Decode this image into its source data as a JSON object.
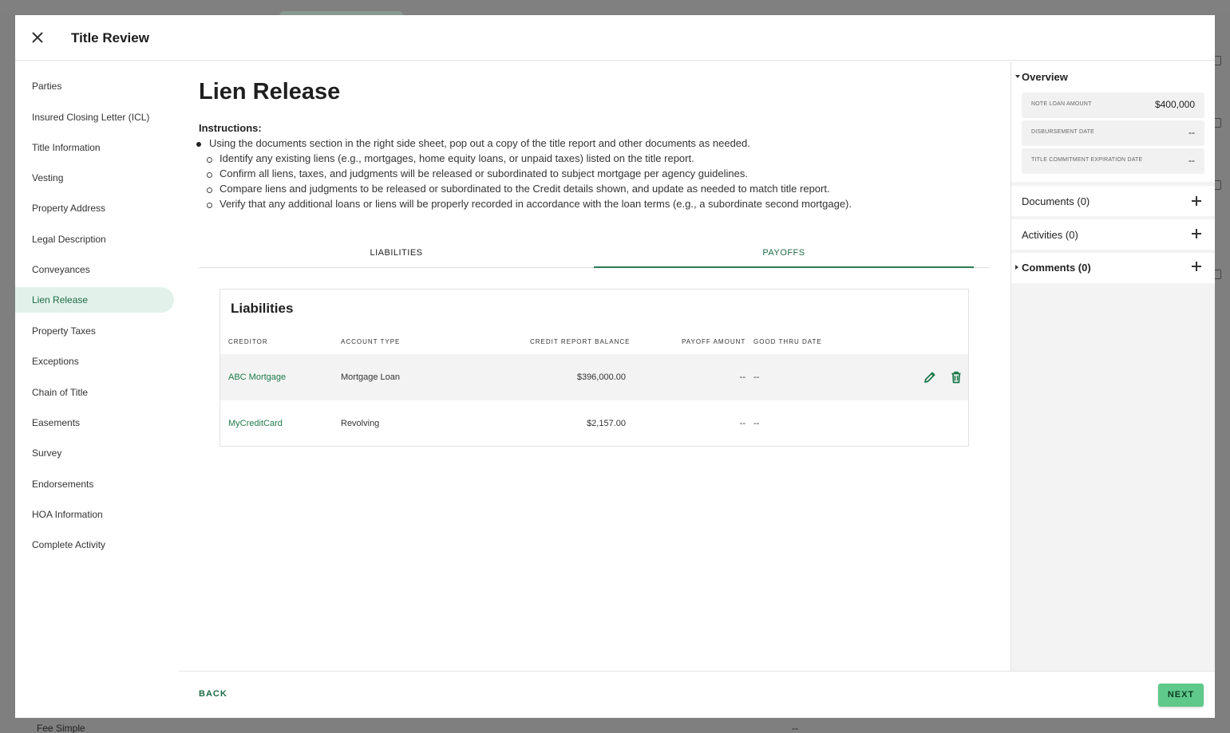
{
  "background": {
    "fee_text": "Fee Simple",
    "dash_text": "--"
  },
  "header": {
    "title": "Title Review",
    "close_icon": "close-icon"
  },
  "sidebar": {
    "items": [
      {
        "label": "Parties"
      },
      {
        "label": "Insured Closing Letter (ICL)"
      },
      {
        "label": "Title Information"
      },
      {
        "label": "Vesting"
      },
      {
        "label": "Property Address"
      },
      {
        "label": "Legal Description"
      },
      {
        "label": "Conveyances"
      },
      {
        "label": "Lien Release",
        "active": true
      },
      {
        "label": "Property Taxes"
      },
      {
        "label": "Exceptions"
      },
      {
        "label": "Chain of Title"
      },
      {
        "label": "Easements"
      },
      {
        "label": "Survey"
      },
      {
        "label": "Endorsements"
      },
      {
        "label": "HOA Information"
      },
      {
        "label": "Complete Activity"
      }
    ]
  },
  "main": {
    "title": "Lien Release",
    "instructions_label": "Instructions:",
    "instructions": {
      "main": "Using the documents section in the right side sheet, pop out a copy of the title report and other documents as needed.",
      "sub": [
        "Identify any existing liens (e.g., mortgages, home equity loans, or unpaid taxes) listed on the title report.",
        "Confirm all liens, taxes, and judgments will be released or subordinated to subject mortgage per agency guidelines.",
        "Compare liens and judgments to be released or subordinated to the Credit details shown, and update as needed to match title report.",
        "Verify that any additional loans or liens will be properly recorded in accordance with the loan terms (e.g., a subordinate second mortgage)."
      ]
    },
    "tabs": [
      {
        "label": "LIABILITIES",
        "active": false
      },
      {
        "label": "PAYOFFS",
        "active": true
      }
    ],
    "table": {
      "title": "Liabilities",
      "columns": [
        "CREDITOR",
        "ACCOUNT TYPE",
        "CREDIT REPORT BALANCE",
        "PAYOFF AMOUNT",
        "GOOD THRU DATE"
      ],
      "rows": [
        {
          "creditor": "ABC Mortgage",
          "account_type": "Mortgage Loan",
          "balance": "$396,000.00",
          "payoff": "--",
          "good_thru": "--",
          "actions": [
            "edit-icon",
            "trash-icon"
          ]
        },
        {
          "creditor": "MyCreditCard",
          "account_type": "Revolving",
          "balance": "$2,157.00",
          "payoff": "--",
          "good_thru": "--",
          "actions": []
        }
      ]
    }
  },
  "footer": {
    "back_label": "BACK",
    "next_label": "NEXT"
  },
  "right_panel": {
    "overview": {
      "title": "Overview",
      "fields": [
        {
          "label": "NOTE LOAN AMOUNT",
          "value": "$400,000"
        },
        {
          "label": "DISBURSEMENT DATE",
          "value": "--"
        },
        {
          "label": "TITLE COMMITMENT EXPIRATION DATE",
          "value": "--"
        }
      ]
    },
    "documents": {
      "label": "Documents (0)"
    },
    "activities": {
      "label": "Activities (0)"
    },
    "comments": {
      "label": "Comments (0)"
    }
  },
  "colors": {
    "accent": "#1d6b45",
    "active_nav_bg": "#e2f2ea",
    "next_button": "#5ec98a"
  }
}
